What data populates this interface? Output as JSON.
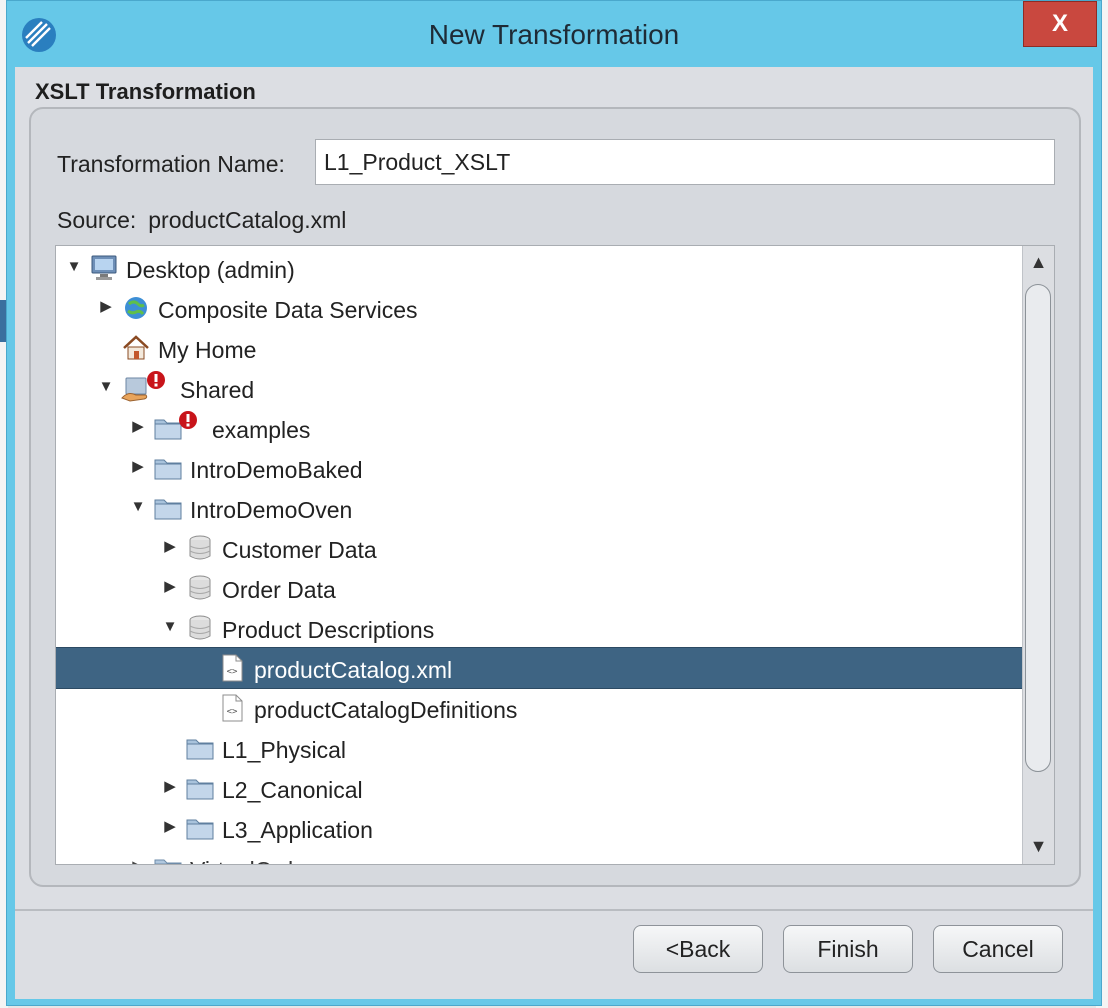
{
  "window": {
    "title": "New Transformation",
    "close_label": "X"
  },
  "dialog": {
    "section_title": "XSLT Transformation",
    "name_label": "Transformation Name:",
    "name_value": "L1_Product_XSLT",
    "source_label": "Source:",
    "source_value": "productCatalog.xml"
  },
  "tree": {
    "nodes": [
      {
        "label": "Desktop (admin)",
        "icon": "computer-icon",
        "expander": "expanded"
      },
      {
        "label": "Composite Data Services",
        "icon": "globe-icon",
        "expander": "collapsed"
      },
      {
        "label": "My Home",
        "icon": "home-icon",
        "expander": "none"
      },
      {
        "label": "Shared",
        "icon": "shared-folder-icon",
        "expander": "expanded",
        "error": true
      },
      {
        "label": "examples",
        "icon": "folder-icon",
        "expander": "collapsed",
        "error": true
      },
      {
        "label": "IntroDemoBaked",
        "icon": "folder-icon",
        "expander": "collapsed"
      },
      {
        "label": "IntroDemoOven",
        "icon": "folder-icon",
        "expander": "expanded"
      },
      {
        "label": "Customer Data",
        "icon": "database-icon",
        "expander": "collapsed"
      },
      {
        "label": "Order Data",
        "icon": "database-icon",
        "expander": "collapsed"
      },
      {
        "label": "Product Descriptions",
        "icon": "database-icon",
        "expander": "expanded"
      },
      {
        "label": "productCatalog.xml",
        "icon": "xml-file-icon",
        "expander": "none",
        "selected": true
      },
      {
        "label": "productCatalogDefinitions",
        "icon": "xml-file-icon",
        "expander": "none"
      },
      {
        "label": "L1_Physical",
        "icon": "folder-icon",
        "expander": "none"
      },
      {
        "label": "L2_Canonical",
        "icon": "folder-icon",
        "expander": "collapsed"
      },
      {
        "label": "L3_Application",
        "icon": "folder-icon",
        "expander": "collapsed"
      },
      {
        "label": "VirtualOrd",
        "icon": "folder-icon",
        "expander": "collapsed",
        "partial": true
      }
    ]
  },
  "buttons": {
    "back": "<Back",
    "finish": "Finish",
    "cancel": "Cancel"
  },
  "colors": {
    "title_bar": "#66c8e8",
    "close_button": "#c9483f",
    "selection": "#3e6483"
  }
}
